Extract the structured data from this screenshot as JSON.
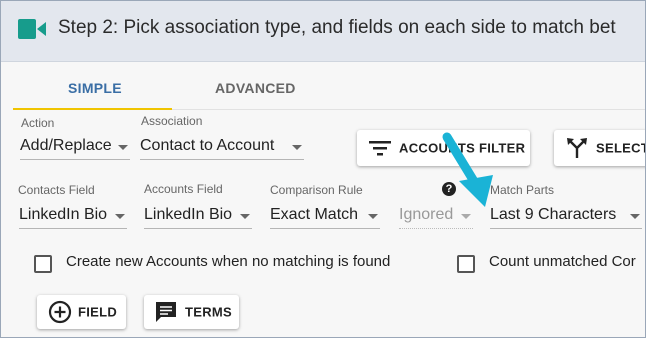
{
  "header": {
    "title": "Step 2: Pick association type, and fields on each side to match bet"
  },
  "tabs": [
    {
      "label": "SIMPLE"
    },
    {
      "label": "ADVANCED"
    }
  ],
  "row1": {
    "action": {
      "label": "Action",
      "value": "Add/Replace"
    },
    "association": {
      "label": "Association",
      "value": "Contact to Account"
    },
    "filter_button": "ACCOUNTS FILTER",
    "select_button": "SELECT"
  },
  "row2": {
    "contacts_field": {
      "label": "Contacts Field",
      "value": "LinkedIn Bio"
    },
    "accounts_field": {
      "label": "Accounts Field",
      "value": "LinkedIn Bio"
    },
    "comparison_rule": {
      "label": "Comparison Rule",
      "value": "Exact Match"
    },
    "ignored": {
      "value": "Ignored"
    },
    "help": "?",
    "match_parts": {
      "label": "Match Parts",
      "value": "Last 9 Characters"
    }
  },
  "options": {
    "create_new": "Create new Accounts when no matching is found",
    "count_unmatched": "Count unmatched Cor"
  },
  "buttons": {
    "field": "FIELD",
    "terms": "TERMS"
  },
  "colors": {
    "accent": "#179c8c",
    "tab_active": "#3a6ea5",
    "underline": "#f0c400",
    "annotation": "#1ab3d6"
  }
}
